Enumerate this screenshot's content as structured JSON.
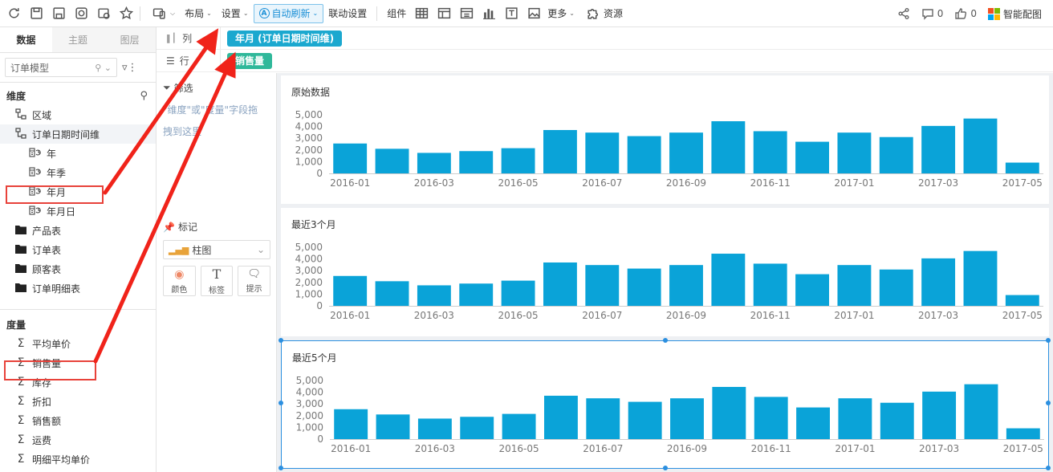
{
  "toolbar": {
    "menus": {
      "layout": "布局",
      "settings": "设置",
      "auto_refresh": "自动刷新",
      "link_settings": "联动设置",
      "components": "组件",
      "more": "更多",
      "resources": "资源"
    },
    "right": {
      "comments_count": "0",
      "likes_count": "0",
      "smart_chart": "智能配图"
    }
  },
  "left_panel": {
    "tabs": [
      "数据",
      "主题",
      "图层"
    ],
    "model_select": "订单模型",
    "dimensions_title": "维度",
    "dimensions": [
      {
        "label": "区域",
        "icon": "hierarchy-icon",
        "level": 0
      },
      {
        "label": "订单日期时间维",
        "icon": "hierarchy-icon",
        "level": 0
      },
      {
        "label": "年",
        "icon": "date-icon",
        "level": 1
      },
      {
        "label": "年季",
        "icon": "date-icon",
        "level": 1
      },
      {
        "label": "年月",
        "icon": "date-icon",
        "level": 1
      },
      {
        "label": "年月日",
        "icon": "date-icon",
        "level": 1
      },
      {
        "label": "产品表",
        "icon": "folder-icon",
        "level": 0
      },
      {
        "label": "订单表",
        "icon": "folder-icon",
        "level": 0
      },
      {
        "label": "顾客表",
        "icon": "folder-icon",
        "level": 0
      },
      {
        "label": "订单明细表",
        "icon": "folder-icon",
        "level": 0
      }
    ],
    "measures_title": "度量",
    "measures": [
      "平均单价",
      "销售量",
      "库存",
      "折扣",
      "销售额",
      "运费",
      "明细平均单价"
    ]
  },
  "shelves": {
    "columns_label": "列",
    "rows_label": "行",
    "column_pill": "年月 (订单日期时间维)",
    "row_pill": "销售量",
    "column_pill_color": "#1ba8cf",
    "row_pill_color": "#2fb89a"
  },
  "filter": {
    "title": "筛选",
    "hint": "\"维度\"或\"度量\"字段拖拽到这里"
  },
  "marks": {
    "title": "标记",
    "chart_type": "柱图",
    "buttons": [
      "颜色",
      "标签",
      "提示"
    ]
  },
  "colors": {
    "bar": "#0aa3d8",
    "accent": "#2b8fe0",
    "highlight": "#e8423a"
  },
  "chart_data": [
    {
      "type": "bar",
      "title": "原始数据",
      "categories": [
        "2016-01",
        "2016-02",
        "2016-03",
        "2016-04",
        "2016-05",
        "2016-06",
        "2016-07",
        "2016-08",
        "2016-09",
        "2016-10",
        "2016-11",
        "2016-12",
        "2017-01",
        "2017-02",
        "2017-03",
        "2017-04",
        "2017-05"
      ],
      "x_tick_labels": [
        "2016-01",
        "2016-03",
        "2016-05",
        "2016-07",
        "2016-09",
        "2016-11",
        "2017-01",
        "2017-03",
        "2017-05"
      ],
      "values": [
        2550,
        2100,
        1750,
        1900,
        2150,
        3700,
        3480,
        3180,
        3480,
        4450,
        3600,
        2700,
        3480,
        3100,
        4050,
        4680,
        920
      ],
      "y_ticks": [
        0,
        1000,
        2000,
        3000,
        4000,
        5000
      ],
      "y_tick_labels": [
        "0",
        "1,000",
        "2,000",
        "3,000",
        "4,000",
        "5,000"
      ],
      "ylim": [
        0,
        5000
      ],
      "grid": false,
      "legend": "none"
    },
    {
      "type": "bar",
      "title": "最近3个月",
      "categories": [
        "2016-01",
        "2016-02",
        "2016-03",
        "2016-04",
        "2016-05",
        "2016-06",
        "2016-07",
        "2016-08",
        "2016-09",
        "2016-10",
        "2016-11",
        "2016-12",
        "2017-01",
        "2017-02",
        "2017-03",
        "2017-04",
        "2017-05"
      ],
      "x_tick_labels": [
        "2016-01",
        "2016-03",
        "2016-05",
        "2016-07",
        "2016-09",
        "2016-11",
        "2017-01",
        "2017-03",
        "2017-05"
      ],
      "values": [
        2550,
        2100,
        1750,
        1900,
        2150,
        3700,
        3480,
        3180,
        3480,
        4450,
        3600,
        2700,
        3480,
        3100,
        4050,
        4680,
        920
      ],
      "y_ticks": [
        0,
        1000,
        2000,
        3000,
        4000,
        5000
      ],
      "y_tick_labels": [
        "0",
        "1,000",
        "2,000",
        "3,000",
        "4,000",
        "5,000"
      ],
      "ylim": [
        0,
        5000
      ],
      "grid": false,
      "legend": "none"
    },
    {
      "type": "bar",
      "title": "最近5个月",
      "categories": [
        "2016-01",
        "2016-02",
        "2016-03",
        "2016-04",
        "2016-05",
        "2016-06",
        "2016-07",
        "2016-08",
        "2016-09",
        "2016-10",
        "2016-11",
        "2016-12",
        "2017-01",
        "2017-02",
        "2017-03",
        "2017-04",
        "2017-05"
      ],
      "x_tick_labels": [
        "2016-01",
        "2016-03",
        "2016-05",
        "2016-07",
        "2016-09",
        "2016-11",
        "2017-01",
        "2017-03",
        "2017-05"
      ],
      "values": [
        2550,
        2100,
        1750,
        1900,
        2150,
        3700,
        3480,
        3180,
        3480,
        4450,
        3600,
        2700,
        3480,
        3100,
        4050,
        4680,
        920
      ],
      "y_ticks": [
        0,
        1000,
        2000,
        3000,
        4000,
        5000
      ],
      "y_tick_labels": [
        "0",
        "1,000",
        "2,000",
        "3,000",
        "4,000",
        "5,000"
      ],
      "ylim": [
        0,
        5000
      ],
      "grid": false,
      "legend": "none"
    }
  ]
}
